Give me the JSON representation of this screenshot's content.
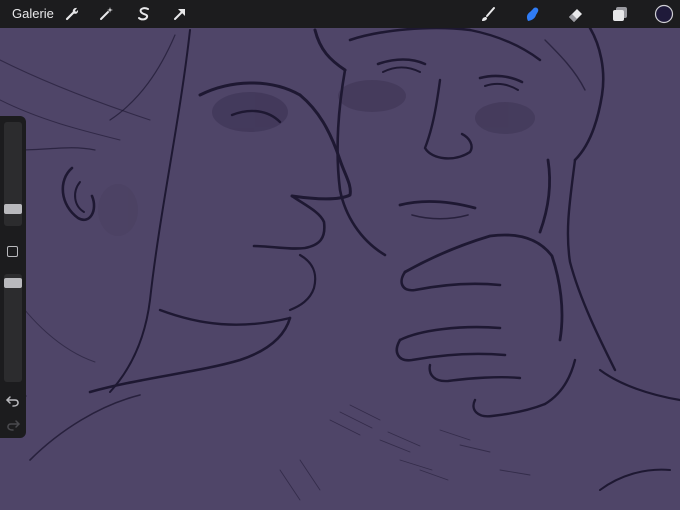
{
  "toolbar": {
    "gallery_label": "Galerie",
    "left_icons": [
      "wrench-icon",
      "magic-wand-icon",
      "selection-icon",
      "transform-arrow-icon"
    ],
    "right_icons": [
      "brush-icon",
      "smudge-icon",
      "eraser-icon",
      "layers-icon",
      "color-swatch"
    ],
    "active_tool": "smudge",
    "active_color": "#1f1a3a",
    "accent_color": "#2f7cf6"
  },
  "sidebar": {
    "brush_size_level": 0.17,
    "opacity_level": 0.0,
    "buttons": [
      "modify-square-button",
      "undo-button",
      "redo-button"
    ]
  },
  "canvas": {
    "background_color": "#4f4568",
    "line_color": "#1e1832",
    "content": "sketch-artwork"
  }
}
